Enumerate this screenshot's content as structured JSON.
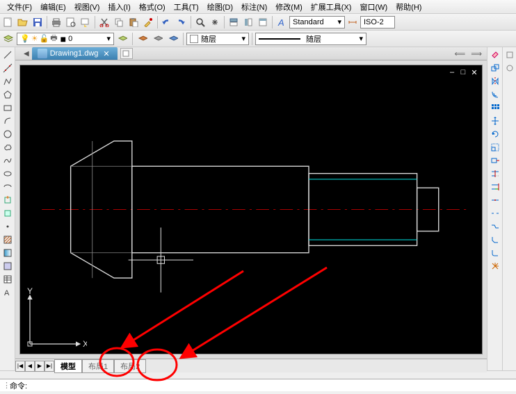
{
  "menu": {
    "file": "文件(F)",
    "edit": "编辑(E)",
    "view": "视图(V)",
    "insert": "插入(I)",
    "format": "格式(O)",
    "tools": "工具(T)",
    "draw": "绘图(D)",
    "annotate": "标注(N)",
    "modify": "修改(M)",
    "extend": "扩展工具(X)",
    "window": "窗口(W)",
    "help": "帮助(H)"
  },
  "toolbar": {
    "style_label": "Standard",
    "iso_label": "ISO-2"
  },
  "props": {
    "layer_name": "0",
    "color_bylayer": "随层",
    "ltype_bylayer": "随层"
  },
  "document": {
    "filename": "Drawing1.dwg"
  },
  "ucs": {
    "x_label": "X",
    "y_label": "Y"
  },
  "bottom_tabs": {
    "model": "模型",
    "layout1": "布局1",
    "layout2": "布局2"
  },
  "cmd": {
    "prompt": "命令:"
  },
  "icons": {
    "bulb": "💡",
    "sun": "☀",
    "lock": "🔒",
    "print": "🖨",
    "color_square": "■"
  }
}
